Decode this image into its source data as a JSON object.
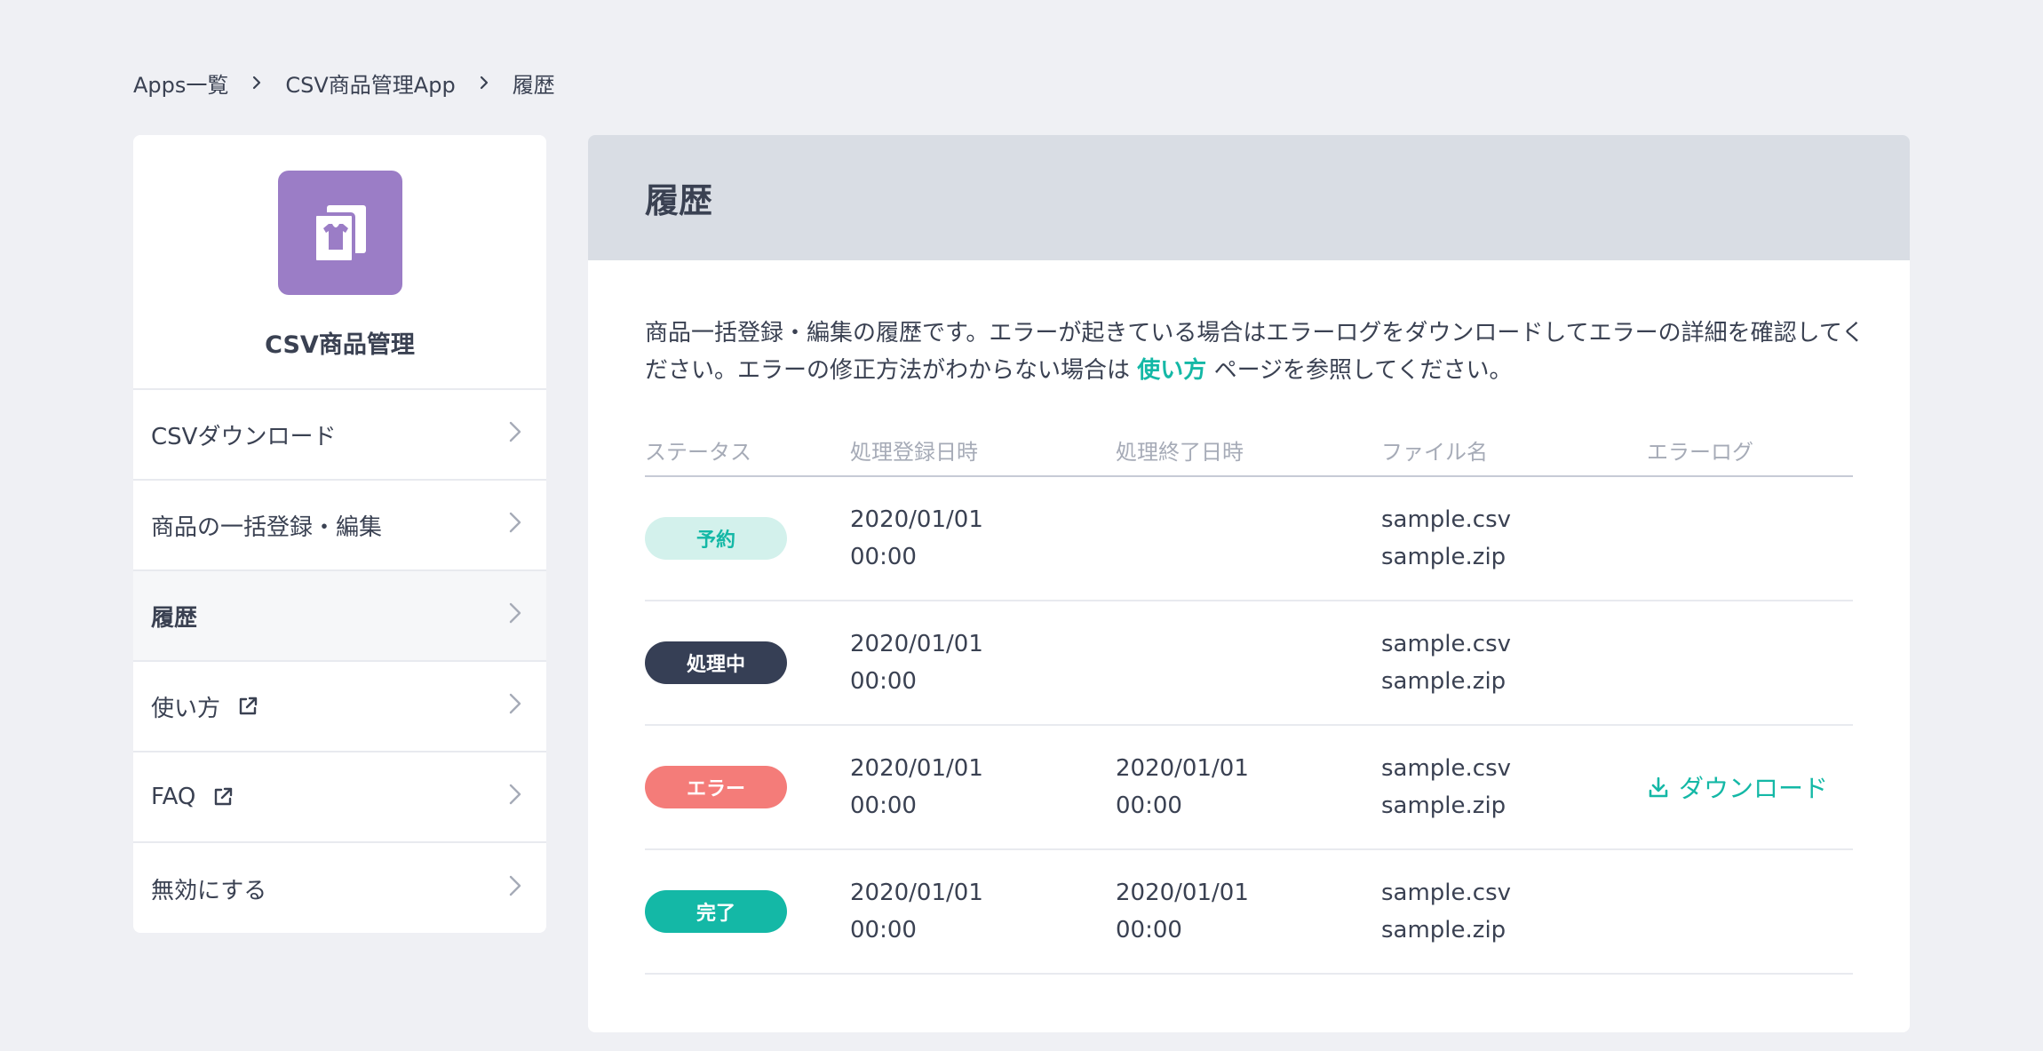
{
  "breadcrumb": {
    "items": [
      "Apps一覧",
      "CSV商品管理App",
      "履歴"
    ]
  },
  "app": {
    "name": "CSV商品管理",
    "icon": "csv-shirt-document-icon",
    "icon_color": "#9b7dc6"
  },
  "sidebar": {
    "items": [
      {
        "label": "CSVダウンロード",
        "external": false,
        "active": false
      },
      {
        "label": "商品の一括登録・編集",
        "external": false,
        "active": false
      },
      {
        "label": "履歴",
        "external": false,
        "active": true
      },
      {
        "label": "使い方",
        "external": true,
        "active": false
      },
      {
        "label": "FAQ",
        "external": true,
        "active": false
      },
      {
        "label": "無効にする",
        "external": false,
        "active": false
      }
    ]
  },
  "main": {
    "title": "履歴",
    "description_before": "商品一括登録・編集の履歴です。エラーが起きている場合はエラーログをダウンロードしてエラーの詳細を確認してください。エラーの修正方法がわからない場合は",
    "description_link": "使い方",
    "description_after": "ページを参照してください。"
  },
  "table": {
    "headers": [
      "ステータス",
      "処理登録日時",
      "処理終了日時",
      "ファイル名",
      "エラーログ"
    ],
    "rows": [
      {
        "status": "予約",
        "status_bg": "#d3f1ec",
        "status_fg": "#14b8a6",
        "registered_date": "2020/01/01",
        "registered_time": "00:00",
        "ended_date": "",
        "ended_time": "",
        "file1": "sample.csv",
        "file2": "sample.zip",
        "error_log": ""
      },
      {
        "status": "処理中",
        "status_bg": "#363f55",
        "status_fg": "#ffffff",
        "registered_date": "2020/01/01",
        "registered_time": "00:00",
        "ended_date": "",
        "ended_time": "",
        "file1": "sample.csv",
        "file2": "sample.zip",
        "error_log": ""
      },
      {
        "status": "エラー",
        "status_bg": "#f47c79",
        "status_fg": "#ffffff",
        "registered_date": "2020/01/01",
        "registered_time": "00:00",
        "ended_date": "2020/01/01",
        "ended_time": "00:00",
        "file1": "sample.csv",
        "file2": "sample.zip",
        "error_log": "ダウンロード"
      },
      {
        "status": "完了",
        "status_bg": "#14b8a6",
        "status_fg": "#ffffff",
        "registered_date": "2020/01/01",
        "registered_time": "00:00",
        "ended_date": "2020/01/01",
        "ended_time": "00:00",
        "file1": "sample.csv",
        "file2": "sample.zip",
        "error_log": ""
      }
    ]
  },
  "colors": {
    "accent": "#14b8a6",
    "background": "#eff0f4",
    "header_bg": "#d9dde4"
  }
}
